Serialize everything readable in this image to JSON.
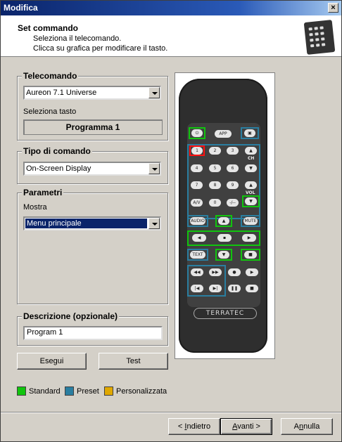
{
  "window": {
    "title": "Modifica",
    "close": "×"
  },
  "header": {
    "title": "Set commando",
    "line1": "Seleziona il telecomando.",
    "line2": "Clicca su grafica per modificare il tasto."
  },
  "telecomando": {
    "legend": "Telecomando",
    "selected": "Aureon 7.1 Universe",
    "key_label": "Seleziona tasto",
    "key_value": "Programma 1"
  },
  "tipo": {
    "legend": "Tipo di comando",
    "selected": "On-Screen Display"
  },
  "parametri": {
    "legend": "Parametri",
    "mostra_label": "Mostra",
    "mostra_selected": "Menu principale"
  },
  "descrizione": {
    "legend": "Descrizione (opzionale)",
    "value": "Program 1"
  },
  "actions": {
    "esegui": "Esegui",
    "test": "Test"
  },
  "legend": [
    {
      "label": "Standard",
      "color": "#11c40e"
    },
    {
      "label": "Preset",
      "color": "#2a7ea0"
    },
    {
      "label": "Personalizzata",
      "color": "#e0a800"
    }
  ],
  "remote": {
    "brand": "TERRATEC",
    "keys": {
      "app": "APP",
      "ch": "CH",
      "vol": "VOL",
      "av": "A/V",
      "sep": "-/--",
      "audio": "AUDIO",
      "mute": "MUTE",
      "text": "TEXT",
      "n1": "1",
      "n2": "2",
      "n3": "3",
      "n4": "4",
      "n5": "5",
      "n6": "6",
      "n7": "7",
      "n8": "8",
      "n9": "9",
      "n0": "0"
    }
  },
  "nav": {
    "back_pre": "< ",
    "back_u": "I",
    "back_post": "ndietro",
    "next_u": "A",
    "next_post": "vanti >",
    "cancel_pre": "A",
    "cancel_u": "n",
    "cancel_post": "nulla"
  }
}
